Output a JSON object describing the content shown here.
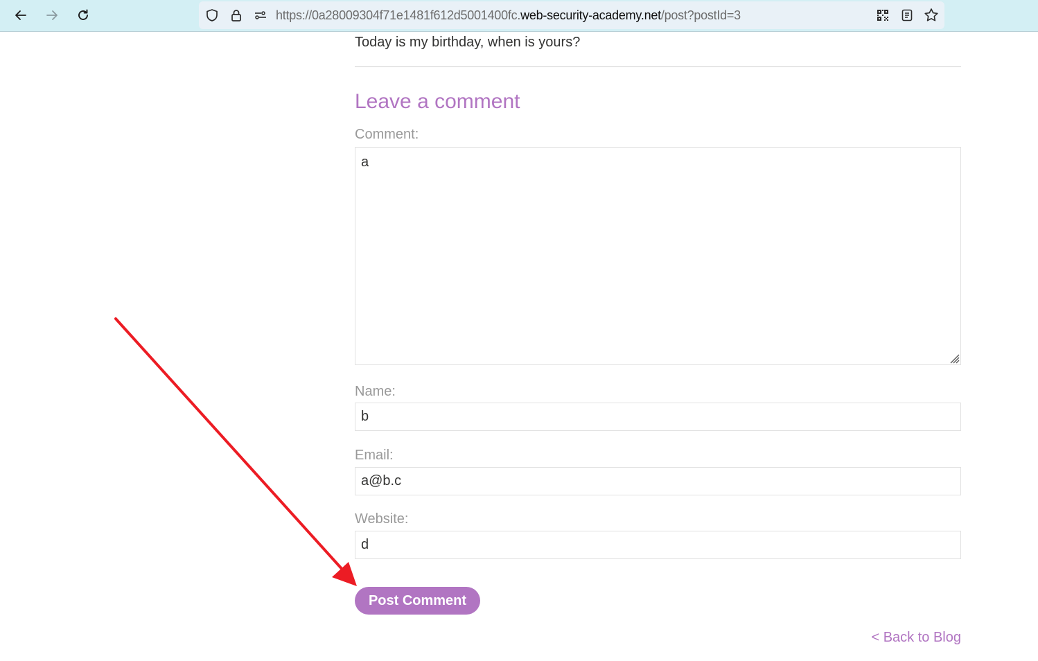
{
  "browser": {
    "url_prefix": "https://0a28009304f71e1481f612d5001400fc.",
    "url_domain": "web-security-academy.net",
    "url_suffix": "/post?postId=3",
    "icons": [
      "back-arrow-icon",
      "forward-arrow-icon",
      "reload-icon",
      "shield-icon",
      "lock-icon",
      "permissions-icon",
      "qr-code-icon",
      "reader-view-icon",
      "bookmark-star-icon"
    ]
  },
  "post": {
    "last_line": "Today is my birthday, when is yours?"
  },
  "comment_form": {
    "heading": "Leave a comment",
    "comment_label": "Comment:",
    "comment_value": "a",
    "name_label": "Name:",
    "name_value": "b",
    "email_label": "Email:",
    "email_value": "a@b.c",
    "website_label": "Website:",
    "website_value": "d",
    "submit_label": "Post Comment"
  },
  "back_link": "< Back to Blog",
  "colors": {
    "accent": "#b175c2",
    "annotation_arrow": "#ec1c24",
    "toolbar_bg": "#d3eff4"
  }
}
